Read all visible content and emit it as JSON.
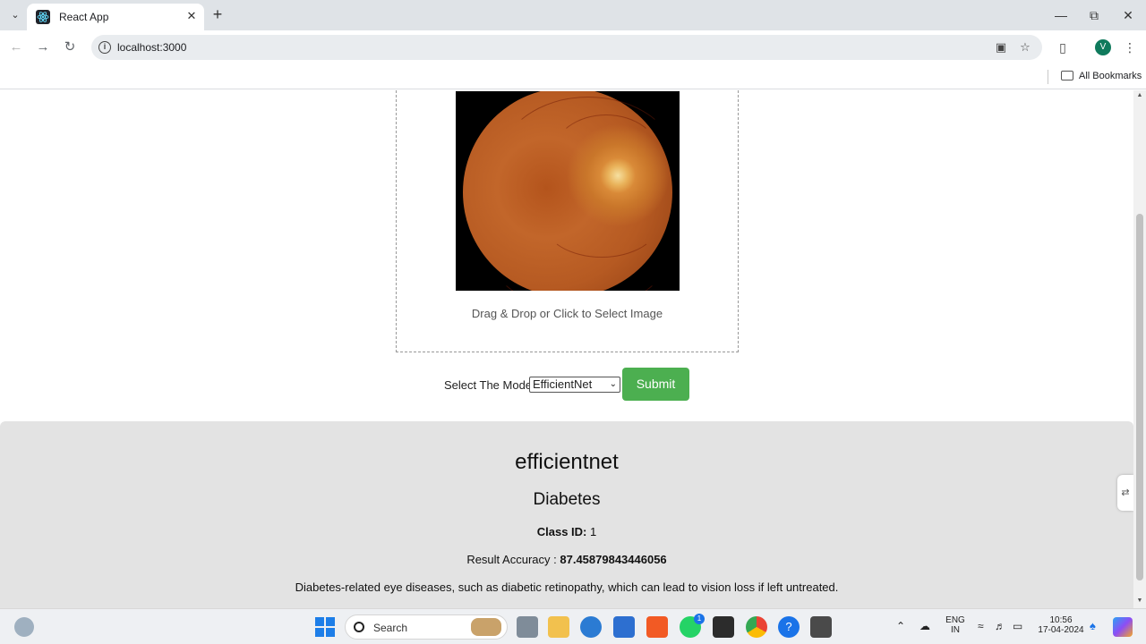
{
  "browser": {
    "tab_title": "React App",
    "url": "localhost:3000",
    "avatar_initial": "V",
    "bookmarks_label": "All Bookmarks"
  },
  "upload": {
    "instruction": "Drag & Drop or Click to Select Image"
  },
  "model_form": {
    "label": "Select The Model",
    "selected_model": "EfficientNet",
    "submit_label": "Submit"
  },
  "result": {
    "model_name": "efficientnet",
    "class_name": "Diabetes",
    "class_id_label": "Class ID:",
    "class_id_value": "1",
    "accuracy_label": "Result Accuracy :",
    "accuracy_value": "87.45879843446056",
    "description": "Diabetes-related eye diseases, such as diabetic retinopathy, which can lead to vision loss if left untreated."
  },
  "taskbar": {
    "search_placeholder": "Search",
    "whatsapp_badge": "1",
    "lang_top": "ENG",
    "lang_bottom": "IN",
    "time": "10:56",
    "date": "17-04-2024"
  },
  "colors": {
    "submit_bg": "#4caf50",
    "result_bg": "#e3e3e3",
    "accent_blue": "#1d7ee8"
  }
}
